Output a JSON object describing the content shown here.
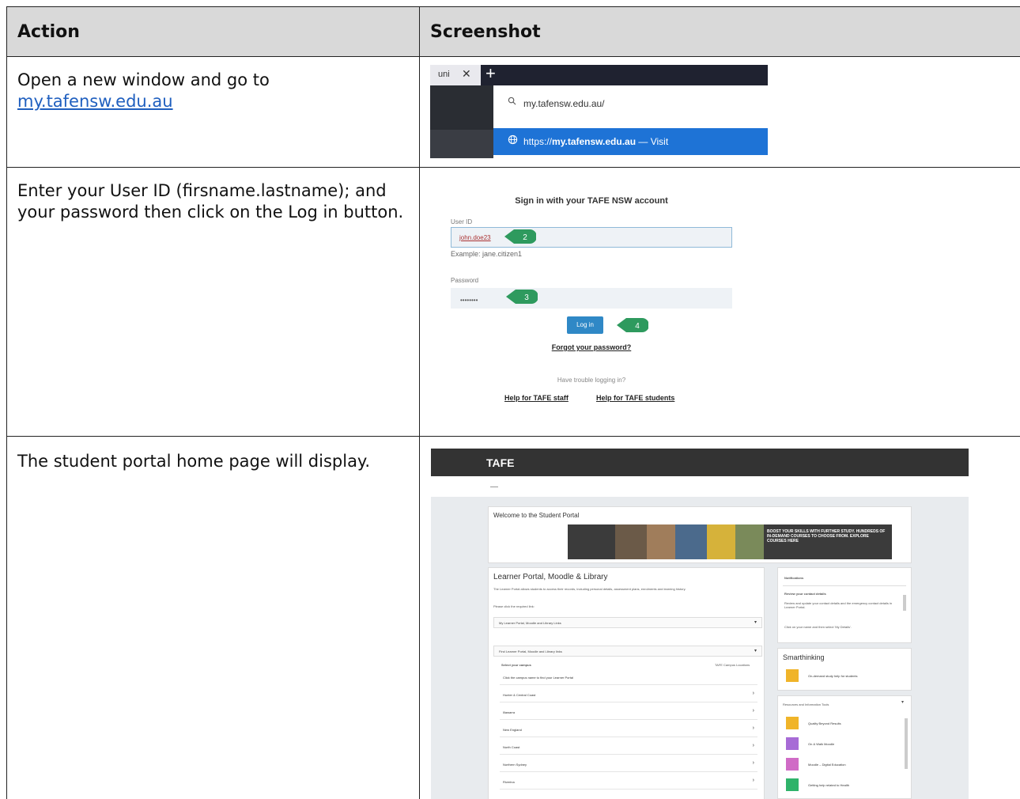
{
  "header": {
    "action": "Action",
    "screenshot": "Screenshot"
  },
  "rows": [
    {
      "action_text": "Open a new window and go to",
      "action_link": "my.tafensw.edu.au",
      "shot": {
        "tab_label": "uni ",
        "url_typed": "my.tafensw.edu.au/",
        "suggestion_prefix": "https://",
        "suggestion_domain": "my.tafensw.edu.au",
        "suggestion_suffix": " — Visit"
      }
    },
    {
      "action_text": "Enter your User ID (firsname.lastname); and your password then click on the Log in button.",
      "shot": {
        "title": "Sign in with your TAFE NSW account",
        "user_id_label": "User ID",
        "user_id_value": "john.doe23",
        "example": "Example: jane.citizen1",
        "password_label": "Password",
        "password_value": "••••••••",
        "login_button": "Log in",
        "forgot": "Forgot your password?",
        "trouble": "Have trouble logging in?",
        "help_staff": "Help for TAFE staff",
        "help_students": "Help for TAFE students",
        "badges": [
          "2",
          "3",
          "4"
        ],
        "badge_color": "#2e9a5e"
      }
    },
    {
      "action_text": "The student portal home page will display.",
      "shot": {
        "logo": "TAFE",
        "welcome": "Welcome to the Student Portal",
        "banner_text": "BOOST YOUR SKILLS WITH FURTHER STUDY. HUNDREDS OF IN-DEMAND COURSES TO CHOOSE FROM. EXPLORE COURSES HERE",
        "learner_title": "Learner Portal, Moodle & Library",
        "learner_desc": "The Learner Portal allows students to access their records, including personal details, assessment plans, enrolments and learning history.",
        "please_click": "Please click the required link:",
        "dropdown1": "My Learner Portal, Moodle and Library Links",
        "dropdown2": "Find Learner Portal, Moodle and Library links",
        "select_campus": "Select your campus",
        "site_list": "TAFE Campus Locations",
        "campus_placeholder": "Click the campus name to find your Learner Portal",
        "regions": [
          "Hunter & Central Coast",
          "Illawarra",
          "New England",
          "North Coast",
          "Northern Sydney",
          "Riverina"
        ],
        "notifications_title": "Notifications",
        "notif_heading": "Review your contact details",
        "notif_text_1": "Review and update your contact details and the emergency contact details in Learner Portal.",
        "notif_text_2": "Click on your name and then select 'My Details'.",
        "smarthinking": "Smarthinking",
        "smarthinking_item": "On-demand study help for students",
        "resources_title": "Resources and Information Tools",
        "resources": [
          "Quality Beyond Results",
          "On & Walk Moodle",
          "Moodle – Digital Education",
          "Getting help related to Health"
        ],
        "resource_colors": [
          "#f0b429",
          "#a76bd6",
          "#d06bc6",
          "#2fb36a"
        ],
        "smarthinking_color": "#f0b429"
      }
    }
  ]
}
